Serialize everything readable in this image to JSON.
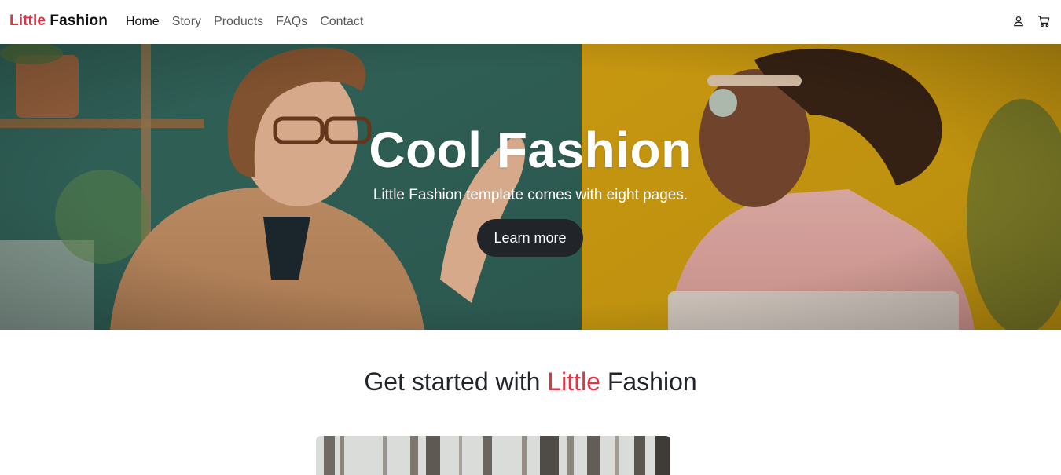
{
  "nav": {
    "brand_accent": "Little",
    "brand_rest": "Fashion",
    "links": [
      "Home",
      "Story",
      "Products",
      "FAQs",
      "Contact"
    ],
    "icons": [
      "user-icon",
      "cart-icon"
    ]
  },
  "hero": {
    "title": "Cool Fashion",
    "subtitle": "Little Fashion template comes with eight pages.",
    "button_label": "Learn more"
  },
  "section": {
    "title_prefix": "Get started with",
    "title_accent": "Little",
    "title_suffix": "Fashion"
  },
  "colors": {
    "accent": "#dc3545",
    "dark": "#212529",
    "teal_wall": "#3f7a6c",
    "yellow_wall": "#d9a514"
  }
}
